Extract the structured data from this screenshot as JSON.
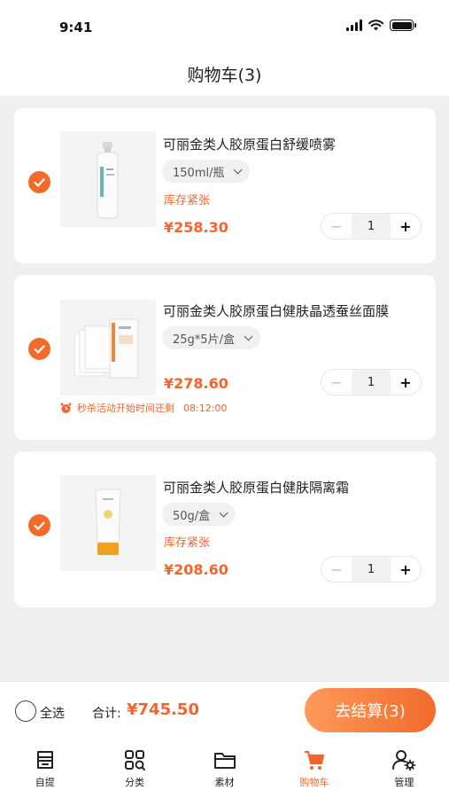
{
  "status": {
    "time": "9:41"
  },
  "header": {
    "title": "购物车(3)"
  },
  "items": [
    {
      "name": "可丽金类人胶原蛋白舒缓喷雾",
      "spec": "150ml/瓶",
      "stock_note": "库存紧张",
      "price": "¥258.30",
      "quantity": "1",
      "checked": true
    },
    {
      "name": "可丽金类人胶原蛋白健肤晶透蚕丝面膜",
      "spec": "25g*5片/盒",
      "price": "¥278.60",
      "quantity": "1",
      "checked": true,
      "flash_sale": {
        "text": "秒杀活动开始时间还剩",
        "countdown": "08:12:00"
      }
    },
    {
      "name": "可丽金类人胶原蛋白健肤隔离霜",
      "spec": "50g/盒",
      "stock_note": "库存紧张",
      "price": "¥208.60",
      "quantity": "1",
      "checked": true
    }
  ],
  "stepper": {
    "minus": "−",
    "plus": "+"
  },
  "checkout": {
    "select_all_label": "全选",
    "total_label": "合计:",
    "total_value": "¥745.50",
    "button_label": "去结算(3)"
  },
  "tabbar": {
    "active": "购物车",
    "tabs": [
      {
        "label": "自提",
        "icon": "pickup-store-icon"
      },
      {
        "label": "分类",
        "icon": "category-grid-icon"
      },
      {
        "label": "素材",
        "icon": "folder-icon"
      },
      {
        "label": "购物车",
        "icon": "cart-icon"
      },
      {
        "label": "管理",
        "icon": "user-settings-icon"
      }
    ]
  },
  "colors": {
    "accent": "#f26b2a",
    "background": "#efefef"
  }
}
